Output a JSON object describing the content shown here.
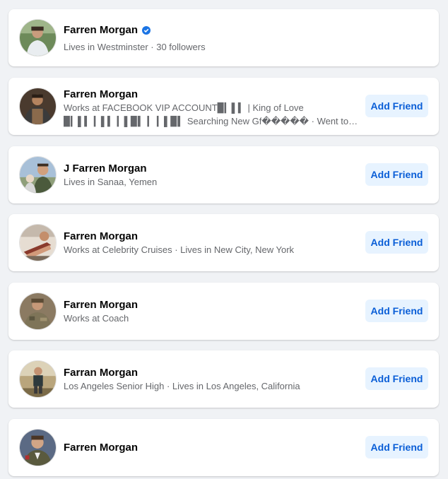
{
  "results": [
    {
      "name": "Farren Morgan",
      "verified": true,
      "details": [
        "Lives in Westminster · 30 followers"
      ],
      "button": null
    },
    {
      "name": "Farren Morgan",
      "verified": false,
      "details": [
        "Works at FACEBOOK VIP ACCOUNT▉▎▌▍ | King of Love",
        "▉▎▌▍ ▎▌▍ ▎▌▉▍ ▎ ▎▌▉▍   Searching New Gf����� · Went to Unite..."
      ],
      "button": "Add Friend"
    },
    {
      "name": "J Farren Morgan",
      "verified": false,
      "details": [
        "Lives in Sanaa, Yemen"
      ],
      "button": "Add Friend"
    },
    {
      "name": "Farren Morgan",
      "verified": false,
      "details": [
        "Works at Celebrity Cruises · Lives in New City, New York"
      ],
      "button": "Add Friend"
    },
    {
      "name": "Farren Morgan",
      "verified": false,
      "details": [
        "Works at Coach"
      ],
      "button": "Add Friend"
    },
    {
      "name": "Farran Morgan",
      "verified": false,
      "details": [
        "Los Angeles Senior High · Lives in Los Angeles, California"
      ],
      "button": "Add Friend"
    },
    {
      "name": "Farren Morgan",
      "verified": false,
      "details": [],
      "button": "Add Friend"
    }
  ],
  "colors": {
    "page_bg": "#f0f2f5",
    "button_bg": "#e7f3ff",
    "button_text": "#0a5ed7",
    "verified": "#1b74e4",
    "secondary_text": "#65676b"
  },
  "icons": {
    "verified": "verified-badge-icon",
    "avatar": "profile-photo"
  }
}
